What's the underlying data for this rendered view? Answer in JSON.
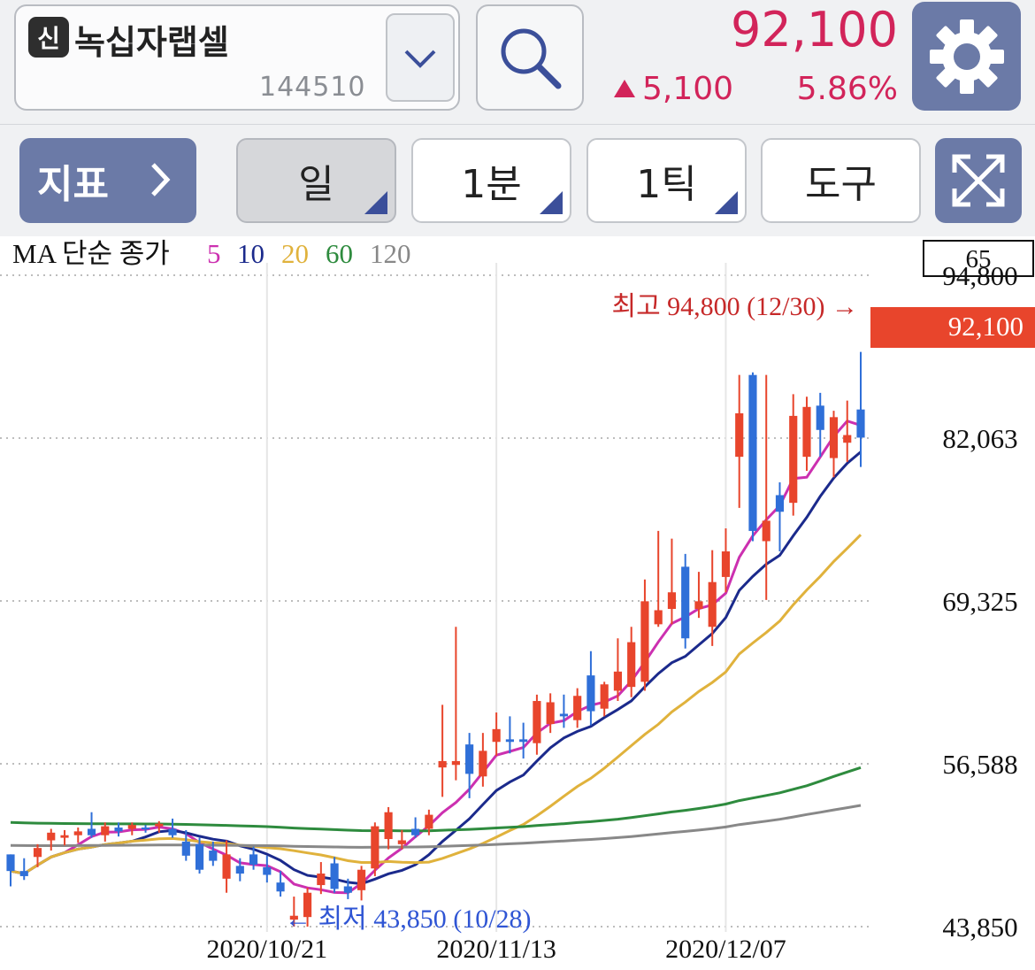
{
  "header": {
    "stock_badge": "신",
    "stock_name": "녹십자랩셀",
    "stock_code": "144510",
    "price": "92,100",
    "change_amount": "5,100",
    "change_percent": "5.86%",
    "icons": [
      "chevron-down-icon",
      "search-icon",
      "gear-icon"
    ],
    "colors": {
      "up": "#d2245a",
      "accent": "#6b7aa7"
    }
  },
  "toolbar": {
    "indicator_label": "지표",
    "period_label": "일",
    "minute_label": "1분",
    "tick_label": "1틱",
    "tools_label": "도구",
    "expand_icon": "expand-icon"
  },
  "chart_data": {
    "type": "candlestick",
    "ma_legend": {
      "label": "MA 단순 종가",
      "periods": [
        {
          "name": "5",
          "color": "#cc30b0"
        },
        {
          "name": "10",
          "color": "#1b2a8c"
        },
        {
          "name": "20",
          "color": "#e0b23c"
        },
        {
          "name": "60",
          "color": "#2e8b3e"
        },
        {
          "name": "120",
          "color": "#888888"
        }
      ]
    },
    "count_box": "65",
    "y_ticks": [
      43850,
      56588,
      69325,
      82063,
      94800
    ],
    "y_tick_labels": [
      "43,850",
      "56,588",
      "69,325",
      "82,063",
      "94,800"
    ],
    "ylim": [
      43850,
      94800
    ],
    "x_labels": [
      "2020/10/21",
      "2020/11/13",
      "2020/12/07"
    ],
    "x_label_indices": [
      19,
      36,
      53
    ],
    "current_price_label": "92,100",
    "max_annotation": "최고 94,800 (12/30) →",
    "min_annotation": "← 최저 43,850 (10/28)",
    "up_color": "#e8452c",
    "down_color": "#2f6fd8",
    "candles": [
      [
        49500,
        49500,
        47000,
        48200
      ],
      [
        48200,
        49200,
        47500,
        47800
      ],
      [
        49300,
        50300,
        48500,
        50000
      ],
      [
        50600,
        51500,
        49800,
        51200
      ],
      [
        50800,
        51400,
        50200,
        51000
      ],
      [
        51000,
        51600,
        50400,
        51300
      ],
      [
        51500,
        52800,
        50800,
        51000
      ],
      [
        51000,
        52000,
        50500,
        51700
      ],
      [
        51600,
        52000,
        50900,
        51300
      ],
      [
        51500,
        52000,
        51000,
        51800
      ],
      [
        51600,
        51800,
        51200,
        51500
      ],
      [
        51700,
        52100,
        51200,
        51900
      ],
      [
        51500,
        52300,
        50800,
        51000
      ],
      [
        50500,
        51400,
        49000,
        49400
      ],
      [
        50300,
        50800,
        48000,
        48300
      ],
      [
        49800,
        50500,
        48600,
        49000
      ],
      [
        47600,
        50600,
        46500,
        49500
      ],
      [
        48600,
        49200,
        47400,
        48000
      ],
      [
        49500,
        50100,
        48300,
        48700
      ],
      [
        48500,
        49400,
        47300,
        47900
      ],
      [
        47300,
        48200,
        46200,
        46600
      ],
      [
        44400,
        46200,
        43850,
        44700
      ],
      [
        44600,
        46900,
        43850,
        46500
      ],
      [
        47100,
        48900,
        46400,
        48000
      ],
      [
        48800,
        49300,
        46500,
        46800
      ],
      [
        47000,
        47600,
        46000,
        46500
      ],
      [
        46700,
        48600,
        45900,
        48300
      ],
      [
        48400,
        52000,
        47800,
        51700
      ],
      [
        50700,
        53200,
        49900,
        52800
      ],
      [
        50300,
        51400,
        49900,
        50600
      ],
      [
        51500,
        52400,
        50800,
        51000
      ],
      [
        51500,
        53000,
        51000,
        52600
      ],
      [
        56300,
        61200,
        54000,
        56800
      ],
      [
        56500,
        67300,
        55300,
        56800
      ],
      [
        58100,
        59000,
        53900,
        55800
      ],
      [
        55600,
        59000,
        54800,
        57600
      ],
      [
        58300,
        60600,
        57200,
        59300
      ],
      [
        58500,
        60300,
        57400,
        58300
      ],
      [
        58500,
        59800,
        57000,
        58300
      ],
      [
        58200,
        62000,
        57300,
        61500
      ],
      [
        59700,
        62100,
        59000,
        61400
      ],
      [
        60500,
        62000,
        59400,
        60300
      ],
      [
        60000,
        62500,
        59400,
        61900
      ],
      [
        63500,
        65400,
        59600,
        60700
      ],
      [
        60900,
        63000,
        60300,
        62800
      ],
      [
        62300,
        66400,
        61500,
        63800
      ],
      [
        62600,
        67300,
        61800,
        66100
      ],
      [
        63000,
        71000,
        62300,
        69300
      ],
      [
        67500,
        74800,
        67300,
        68600
      ],
      [
        68700,
        74200,
        67500,
        70000
      ],
      [
        72000,
        73000,
        65600,
        66400
      ],
      [
        68700,
        71600,
        68000,
        69300
      ],
      [
        67300,
        73300,
        65800,
        70800
      ],
      [
        71200,
        75000,
        70000,
        73200
      ],
      [
        80600,
        87000,
        76600,
        84000
      ],
      [
        87000,
        87200,
        74000,
        74800
      ],
      [
        74000,
        87000,
        69400,
        75600
      ],
      [
        77600,
        78600,
        73200,
        76300
      ],
      [
        77000,
        85500,
        76000,
        83800
      ],
      [
        80600,
        85300,
        79500,
        84500
      ],
      [
        84600,
        85600,
        80600,
        82700
      ],
      [
        80500,
        84200,
        79000,
        83700
      ],
      [
        81700,
        85000,
        80200,
        82300
      ],
      [
        84300,
        88800,
        79800,
        82100
      ]
    ]
  }
}
